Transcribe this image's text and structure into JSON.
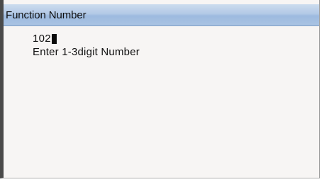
{
  "window": {
    "title": "Function Number"
  },
  "entry": {
    "value": "102",
    "prompt": "Enter 1-3digit Number"
  }
}
